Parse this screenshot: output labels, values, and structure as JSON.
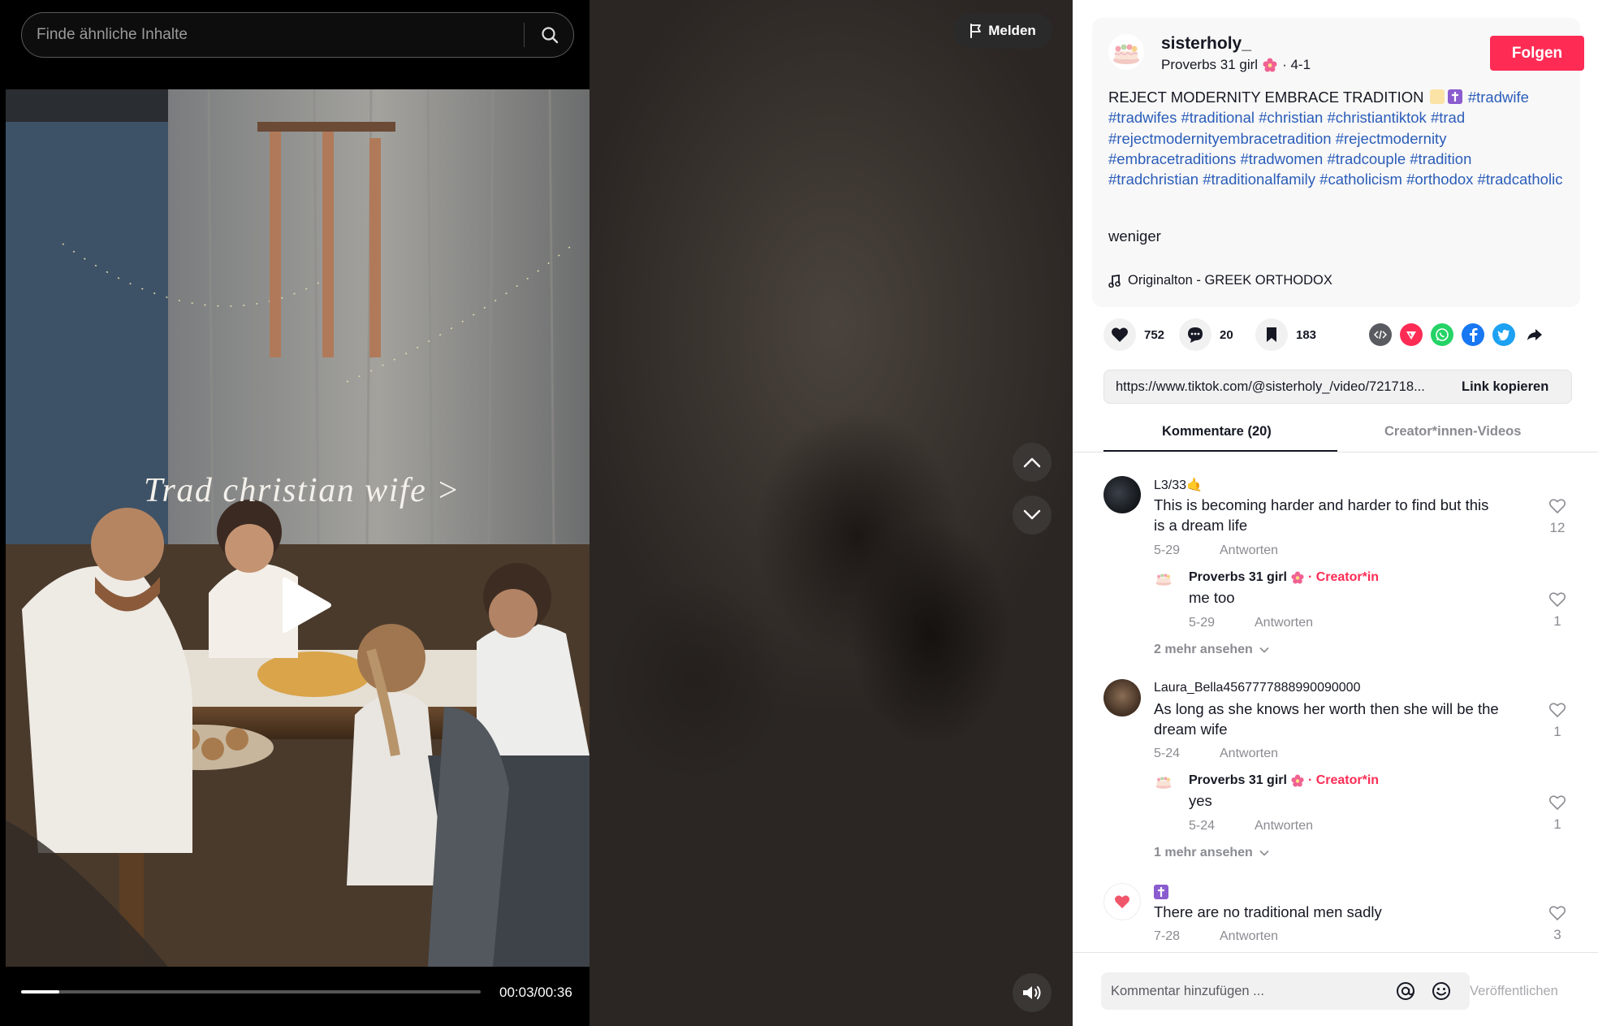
{
  "search": {
    "placeholder": "Finde ähnliche Inhalte"
  },
  "video": {
    "overlay_text": "Trad christian wife >",
    "time": "00:03/00:36",
    "progress": 0.0833
  },
  "controls": {
    "report_label": "Melden"
  },
  "author": {
    "username": "sisterholy_",
    "nickname": "Proverbs 31 girl",
    "date": "· 4-1",
    "follow_label": "Folgen"
  },
  "caption": {
    "text": "REJECT MODERNITY EMBRACE TRADITION",
    "hashtags": [
      "#tradwife",
      "#tradwifes",
      "#traditional",
      "#christian",
      "#christiantiktok",
      "#trad",
      "#rejectmodernityembracetradition",
      "#rejectmodernity",
      "#embracetraditions",
      "#tradwomen",
      "#tradcouple",
      "#tradition",
      "#tradchristian",
      "#traditionalfamily",
      "#catholicism",
      "#orthodox",
      "#tradcatholic"
    ],
    "less_label": "weniger"
  },
  "music": {
    "label": "Originalton - GREEK ORTHODOX"
  },
  "stats": {
    "likes": "752",
    "comments": "20",
    "saves": "183"
  },
  "share_icons": [
    "embed-icon",
    "send-icon",
    "whatsapp-icon",
    "facebook-icon",
    "twitter-icon",
    "share-arrow-icon"
  ],
  "link": {
    "url": "https://www.tiktok.com/@sisterholy_/video/721718...",
    "copy_label": "Link kopieren"
  },
  "tabs": {
    "comments": "Kommentare (20)",
    "videos": "Creator*innen-Videos"
  },
  "comments": [
    {
      "user": "L3/33🤙",
      "text_line1": "This is becoming harder and harder to find but this",
      "text_line2": "is a dream life",
      "date": "5-29",
      "reply_label": "Antworten",
      "likes": "12",
      "reply": {
        "user": "Proverbs 31 girl",
        "creator_label": "· Creator*in",
        "text": "me too",
        "date": "5-29",
        "reply_label": "Antworten",
        "likes": "1"
      },
      "more": "2 mehr ansehen"
    },
    {
      "user": "Laura_Bella4567777888990090000",
      "text_line1": "As long as she knows her worth then she will be the",
      "text_line2": "dream wife",
      "date": "5-24",
      "reply_label": "Antworten",
      "likes": "1",
      "reply": {
        "user": "Proverbs 31 girl",
        "creator_label": "· Creator*in",
        "text": "yes",
        "date": "5-24",
        "reply_label": "Antworten",
        "likes": "1"
      },
      "more": "1 mehr ansehen"
    },
    {
      "user": "",
      "text_line1": "There are no traditional men sadly",
      "date": "7-28",
      "reply_label": "Antworten",
      "likes": "3"
    }
  ],
  "comment_bar": {
    "placeholder": "Kommentar hinzufügen ...",
    "publish_label": "Veröffentlichen"
  },
  "colors": {
    "accent": "#fe2c55",
    "hashtag": "#2b5db9",
    "muted": "#8a8b91"
  }
}
